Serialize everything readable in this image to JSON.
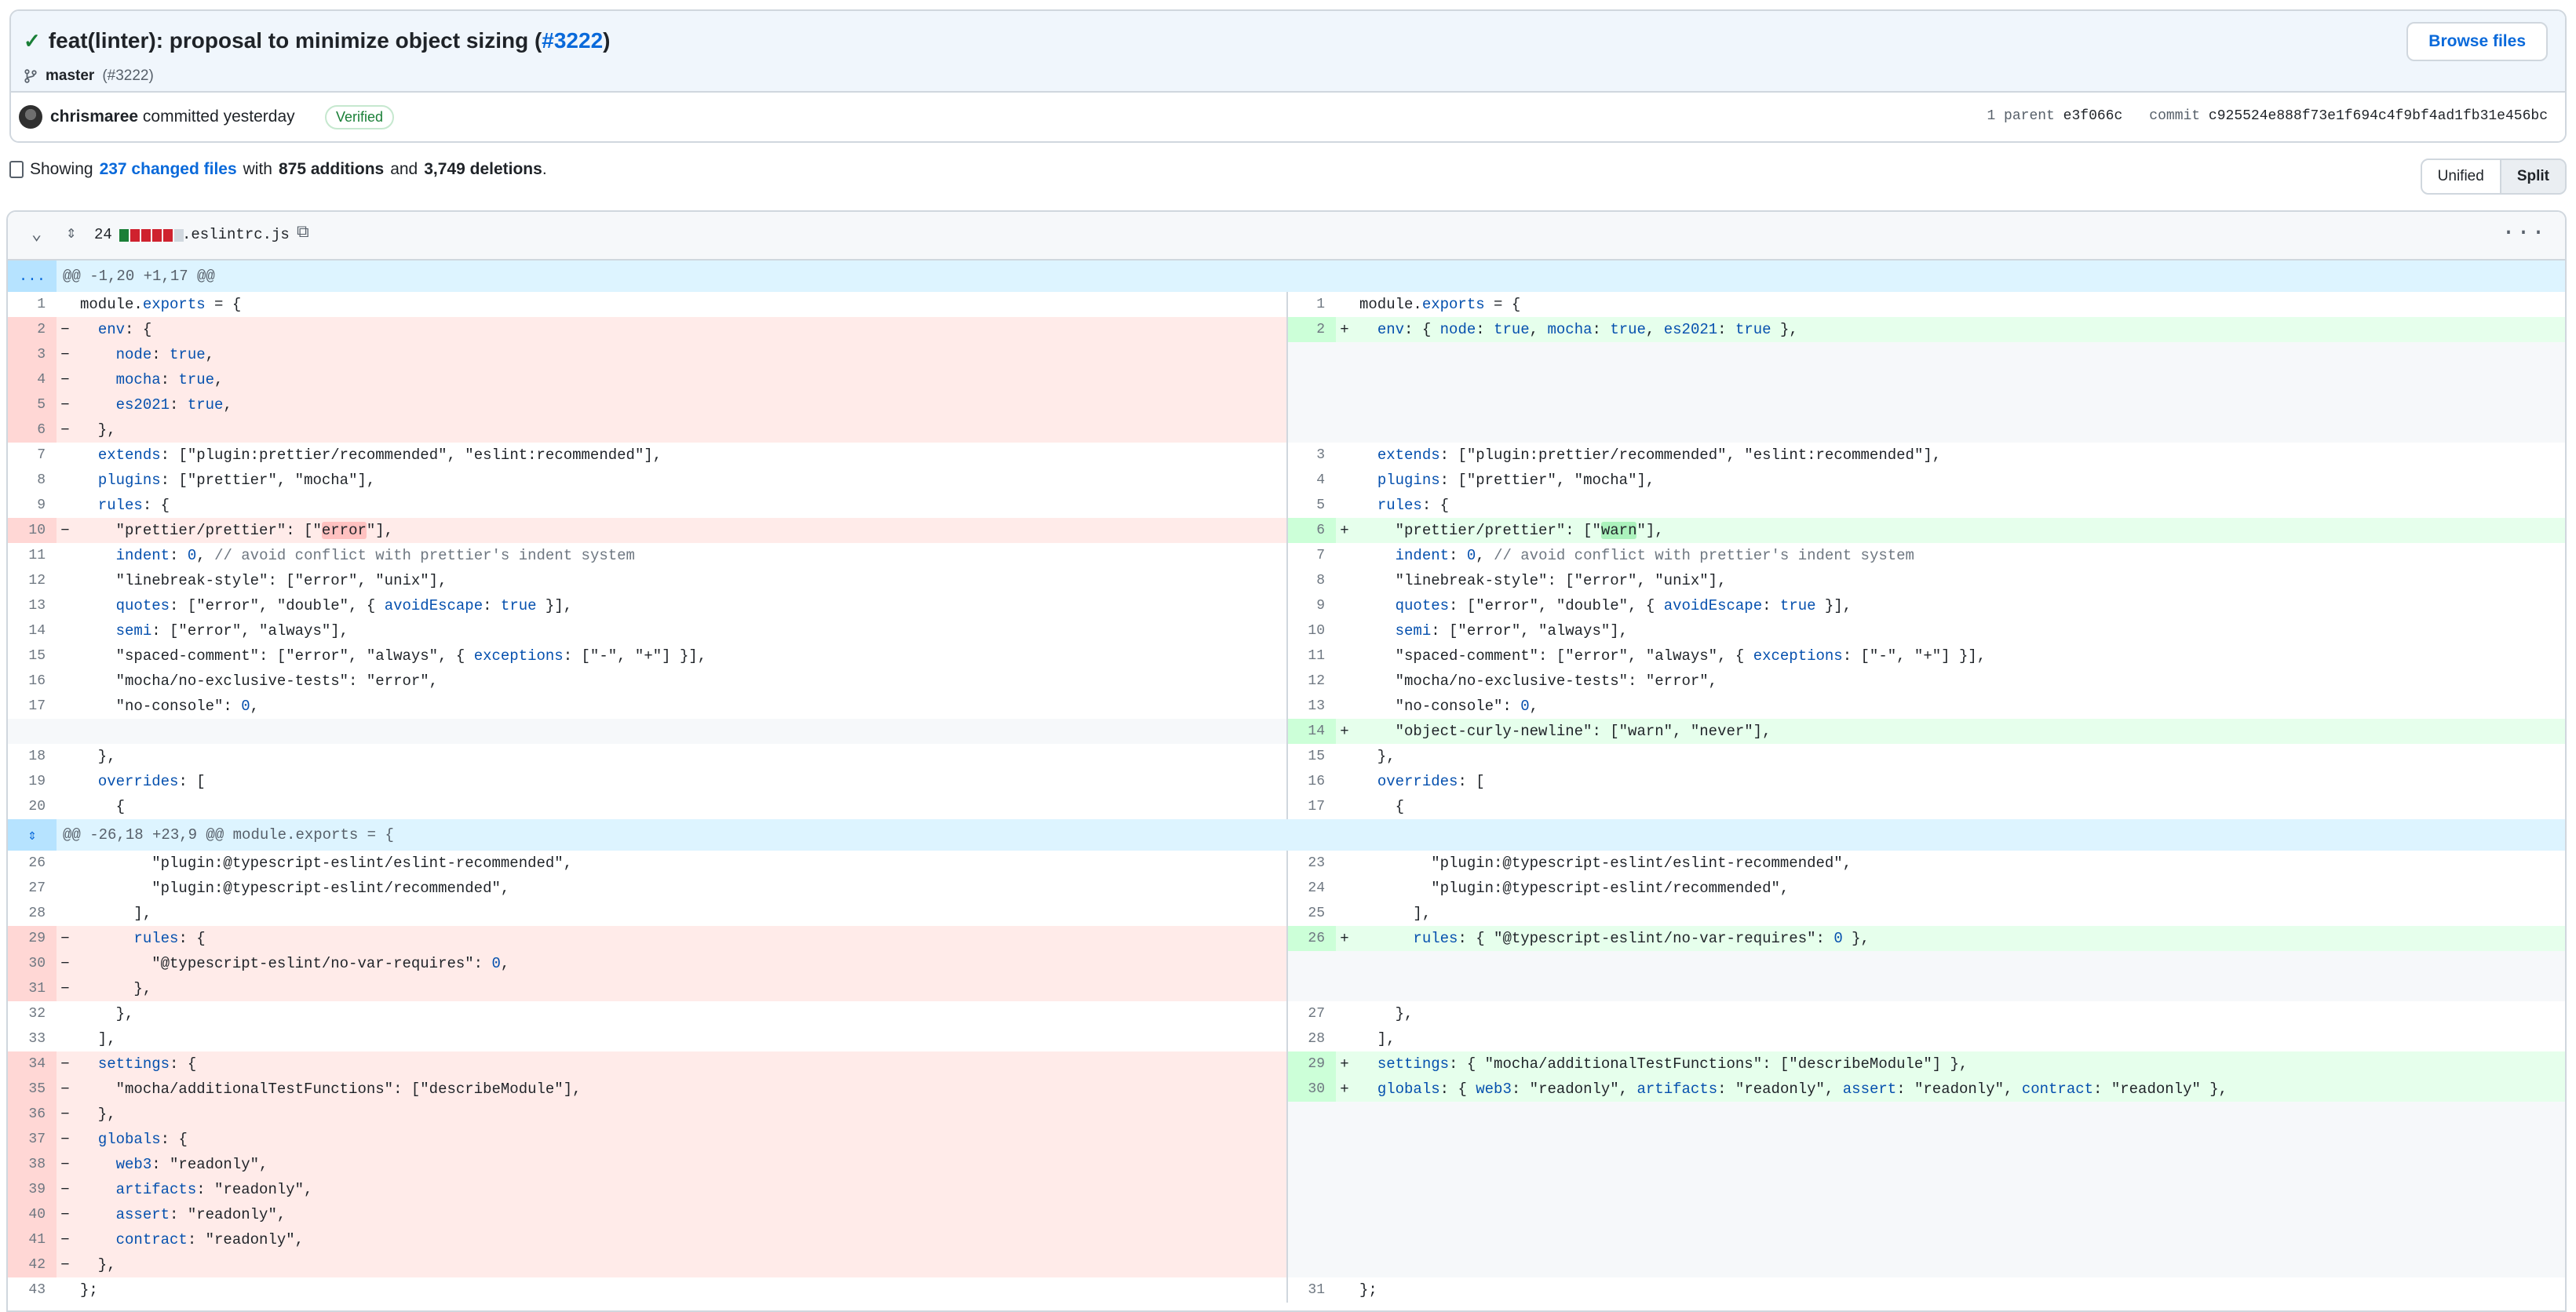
{
  "commit": {
    "title_prefix": "feat(linter): proposal to minimize object sizing (",
    "pr_ref": "#3222",
    "title_suffix": ")",
    "branch": "master",
    "branch_ref": "(#3222)",
    "browse_label": "Browse files",
    "author": "chrismaree",
    "committed": "committed yesterday",
    "verified": "Verified",
    "parent_label": "1 parent",
    "parent_sha": "e3f066c",
    "commit_label": "commit",
    "commit_sha": "c925524e888f73e1f694c4f9bf4ad1fb31e456bc"
  },
  "summary": {
    "showing": "Showing",
    "changed_files": "237 changed files",
    "with": "with",
    "additions": "875 additions",
    "and": "and",
    "deletions": "3,749 deletions",
    "period": "."
  },
  "view_toggle": {
    "unified": "Unified",
    "split": "Split",
    "active": "Split"
  },
  "file": {
    "change_count": "24",
    "name": ".eslintrc.js",
    "bar_colors": [
      "#1a7f37",
      "#cf222e",
      "#cf222e",
      "#cf222e",
      "#cf222e",
      "#d0d7de"
    ]
  },
  "hunks": [
    {
      "header": "@@ -1,20 +1,17 @@",
      "expander_icon": "ellipsis-icon",
      "rows": [
        {
          "t": "ctx",
          "ln": "1",
          "lc": "module.exports = {",
          "rn": "1",
          "rc": "module.exports = {"
        },
        {
          "t": "chg",
          "ln": "2",
          "lc": "  env: {",
          "rn": "2",
          "rc": "  env: { node: true, mocha: true, es2021: true },"
        },
        {
          "t": "del",
          "ln": "3",
          "lc": "    node: true,"
        },
        {
          "t": "del",
          "ln": "4",
          "lc": "    mocha: true,"
        },
        {
          "t": "del",
          "ln": "5",
          "lc": "    es2021: true,"
        },
        {
          "t": "del",
          "ln": "6",
          "lc": "  },"
        },
        {
          "t": "ctx",
          "ln": "7",
          "lc": "  extends: [\"plugin:prettier/recommended\", \"eslint:recommended\"],",
          "rn": "3",
          "rc": "  extends: [\"plugin:prettier/recommended\", \"eslint:recommended\"],"
        },
        {
          "t": "ctx",
          "ln": "8",
          "lc": "  plugins: [\"prettier\", \"mocha\"],",
          "rn": "4",
          "rc": "  plugins: [\"prettier\", \"mocha\"],"
        },
        {
          "t": "ctx",
          "ln": "9",
          "lc": "  rules: {",
          "rn": "5",
          "rc": "  rules: {"
        },
        {
          "t": "chg",
          "ln": "10",
          "lc": "    \"prettier/prettier\": [\"error\"],",
          "rn": "6",
          "rc": "    \"prettier/prettier\": [\"warn\"],"
        },
        {
          "t": "ctx",
          "ln": "11",
          "lc": "    indent: 0, // avoid conflict with prettier's indent system",
          "rn": "7",
          "rc": "    indent: 0, // avoid conflict with prettier's indent system"
        },
        {
          "t": "ctx",
          "ln": "12",
          "lc": "    \"linebreak-style\": [\"error\", \"unix\"],",
          "rn": "8",
          "rc": "    \"linebreak-style\": [\"error\", \"unix\"],"
        },
        {
          "t": "ctx",
          "ln": "13",
          "lc": "    quotes: [\"error\", \"double\", { avoidEscape: true }],",
          "rn": "9",
          "rc": "    quotes: [\"error\", \"double\", { avoidEscape: true }],"
        },
        {
          "t": "ctx",
          "ln": "14",
          "lc": "    semi: [\"error\", \"always\"],",
          "rn": "10",
          "rc": "    semi: [\"error\", \"always\"],"
        },
        {
          "t": "ctx",
          "ln": "15",
          "lc": "    \"spaced-comment\": [\"error\", \"always\", { exceptions: [\"-\", \"+\"] }],",
          "rn": "11",
          "rc": "    \"spaced-comment\": [\"error\", \"always\", { exceptions: [\"-\", \"+\"] }],"
        },
        {
          "t": "ctx",
          "ln": "16",
          "lc": "    \"mocha/no-exclusive-tests\": \"error\",",
          "rn": "12",
          "rc": "    \"mocha/no-exclusive-tests\": \"error\","
        },
        {
          "t": "ctx",
          "ln": "17",
          "lc": "    \"no-console\": 0,",
          "rn": "13",
          "rc": "    \"no-console\": 0,"
        },
        {
          "t": "add",
          "rn": "14",
          "rc": "    \"object-curly-newline\": [\"warn\", \"never\"],"
        },
        {
          "t": "ctx",
          "ln": "18",
          "lc": "  },",
          "rn": "15",
          "rc": "  },"
        },
        {
          "t": "ctx",
          "ln": "19",
          "lc": "  overrides: [",
          "rn": "16",
          "rc": "  overrides: ["
        },
        {
          "t": "ctx",
          "ln": "20",
          "lc": "    {",
          "rn": "17",
          "rc": "    {"
        }
      ]
    },
    {
      "header": "@@ -26,18 +23,9 @@ module.exports = {",
      "expander_icon": "expand-icon",
      "rows": [
        {
          "t": "ctx",
          "ln": "26",
          "lc": "        \"plugin:@typescript-eslint/eslint-recommended\",",
          "rn": "23",
          "rc": "        \"plugin:@typescript-eslint/eslint-recommended\","
        },
        {
          "t": "ctx",
          "ln": "27",
          "lc": "        \"plugin:@typescript-eslint/recommended\",",
          "rn": "24",
          "rc": "        \"plugin:@typescript-eslint/recommended\","
        },
        {
          "t": "ctx",
          "ln": "28",
          "lc": "      ],",
          "rn": "25",
          "rc": "      ],"
        },
        {
          "t": "chg",
          "ln": "29",
          "lc": "      rules: {",
          "rn": "26",
          "rc": "      rules: { \"@typescript-eslint/no-var-requires\": 0 },"
        },
        {
          "t": "del",
          "ln": "30",
          "lc": "        \"@typescript-eslint/no-var-requires\": 0,"
        },
        {
          "t": "del",
          "ln": "31",
          "lc": "      },"
        },
        {
          "t": "ctx",
          "ln": "32",
          "lc": "    },",
          "rn": "27",
          "rc": "    },"
        },
        {
          "t": "ctx",
          "ln": "33",
          "lc": "  ],",
          "rn": "28",
          "rc": "  ],"
        },
        {
          "t": "chg",
          "ln": "34",
          "lc": "  settings: {",
          "rn": "29",
          "rc": "  settings: { \"mocha/additionalTestFunctions\": [\"describeModule\"] },"
        },
        {
          "t": "chg",
          "ln": "35",
          "lc": "    \"mocha/additionalTestFunctions\": [\"describeModule\"],",
          "rn": "30",
          "rc": "  globals: { web3: \"readonly\", artifacts: \"readonly\", assert: \"readonly\", contract: \"readonly\" },"
        },
        {
          "t": "del",
          "ln": "36",
          "lc": "  },"
        },
        {
          "t": "del",
          "ln": "37",
          "lc": "  globals: {"
        },
        {
          "t": "del",
          "ln": "38",
          "lc": "    web3: \"readonly\","
        },
        {
          "t": "del",
          "ln": "39",
          "lc": "    artifacts: \"readonly\","
        },
        {
          "t": "del",
          "ln": "40",
          "lc": "    assert: \"readonly\","
        },
        {
          "t": "del",
          "ln": "41",
          "lc": "    contract: \"readonly\","
        },
        {
          "t": "del",
          "ln": "42",
          "lc": "  },"
        },
        {
          "t": "ctx",
          "ln": "43",
          "lc": "};",
          "rn": "31",
          "rc": "};"
        }
      ]
    }
  ],
  "icons": {
    "check": "check-icon",
    "branch": "git-branch-icon",
    "collapse": "chevron-down-icon",
    "expand": "expand-icon",
    "copy": "copy-icon",
    "more": "kebab-horizontal-icon",
    "file": "file-diff-icon"
  }
}
